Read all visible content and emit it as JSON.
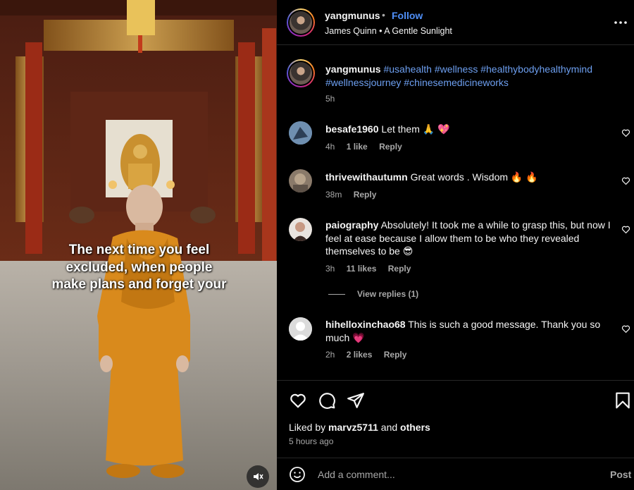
{
  "media": {
    "caption": "The next time you feel excluded, when people make plans and forget your",
    "mute_icon": "speaker-muted-icon"
  },
  "header": {
    "username": "yangmunus",
    "separator": "•",
    "follow_label": "Follow",
    "subtitle": "James Quinn • A Gentle Sunlight",
    "more_icon": "more-horizontal-icon"
  },
  "caption_post": {
    "username": "yangmunus",
    "hashtags": "#usahealth #wellness #healthybodyhealthymind #wellnessjourney #chinesemedicineworks",
    "time": "5h"
  },
  "comments": [
    {
      "username": "besafe1960",
      "text": "Let them 🙏 💖",
      "time": "4h",
      "likes": "1 like",
      "reply": "Reply"
    },
    {
      "username": "thrivewithautumn",
      "text": "Great words . Wisdom 🔥 🔥",
      "time": "38m",
      "likes": "",
      "reply": "Reply"
    },
    {
      "username": "paiography",
      "text": "Absolutely! It took me a while to grasp this, but now I feel at ease because I allow them to be who they revealed themselves to be 😎",
      "time": "3h",
      "likes": "11 likes",
      "reply": "Reply",
      "view_replies": "View replies (1)"
    },
    {
      "username": "hihelloxinchao68",
      "text": "This is such a good message. Thank you so much 💗",
      "time": "2h",
      "likes": "2 likes",
      "reply": "Reply"
    }
  ],
  "actions": {
    "liked_by_prefix": "Liked by",
    "liked_by_user": "marvz5711",
    "liked_by_and": "and",
    "liked_by_others": "others",
    "time_ago": "5 hours ago"
  },
  "composer": {
    "placeholder": "Add a comment...",
    "post_label": "Post"
  },
  "colors": {
    "background": "#000000",
    "link_blue": "#4f8ff7",
    "hashtag": "#6d9ff0",
    "muted_text": "#a8a8a8",
    "robe": "#d98a1c"
  }
}
